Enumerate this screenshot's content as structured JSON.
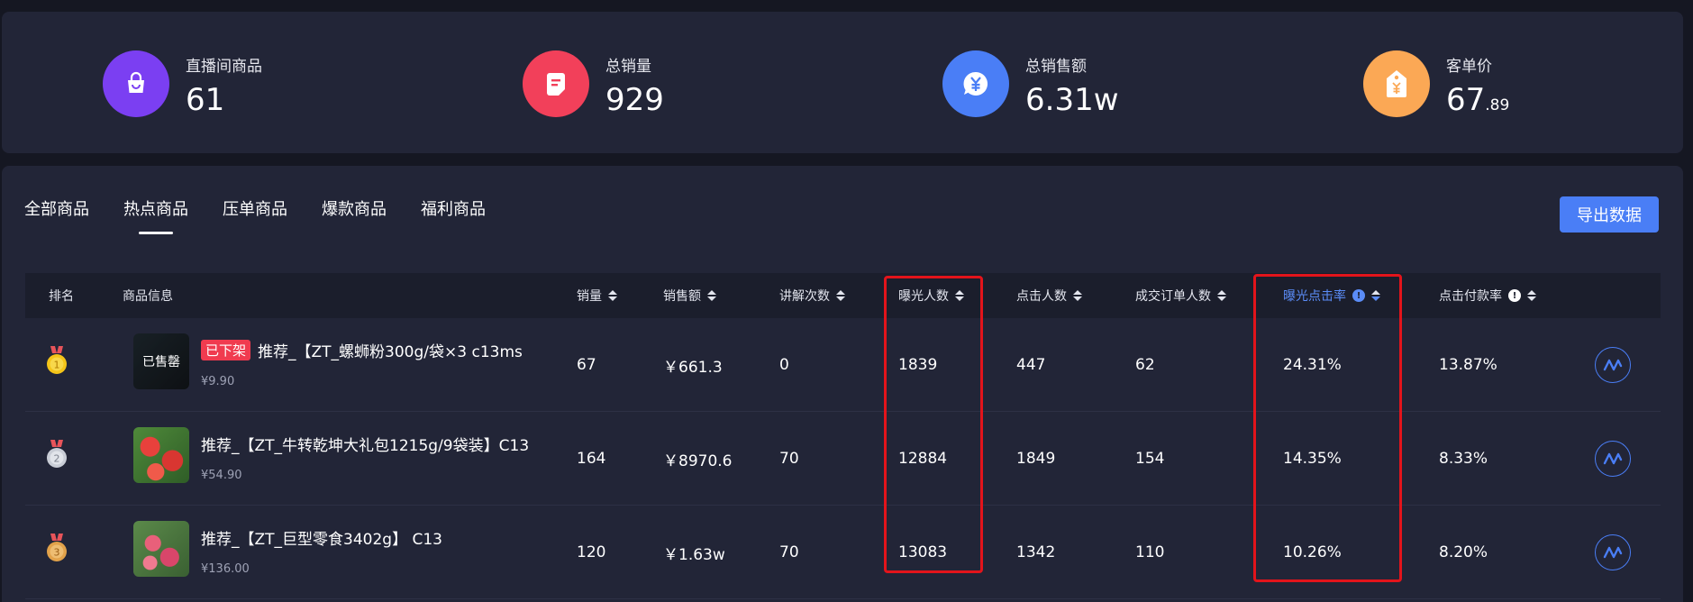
{
  "stats": [
    {
      "label": "直播间商品",
      "value": "61",
      "decimal": "",
      "icon": "shopping-bag-icon",
      "color": "#7b3ff2"
    },
    {
      "label": "总销量",
      "value": "929",
      "decimal": "",
      "icon": "document-icon",
      "color": "#f2405a"
    },
    {
      "label": "总销售额",
      "value": "6.31w",
      "decimal": "",
      "icon": "yuan-bubble-icon",
      "color": "#4a7ef6"
    },
    {
      "label": "客单价",
      "value": "67",
      "decimal": ".89",
      "icon": "price-tag-icon",
      "color": "#fba855"
    }
  ],
  "tabs": [
    {
      "label": "全部商品",
      "active": false
    },
    {
      "label": "热点商品",
      "active": true
    },
    {
      "label": "压单商品",
      "active": false
    },
    {
      "label": "爆款商品",
      "active": false
    },
    {
      "label": "福利商品",
      "active": false
    }
  ],
  "export_label": "导出数据",
  "columns": [
    {
      "label": "排名",
      "sortable": false
    },
    {
      "label": "商品信息",
      "sortable": false
    },
    {
      "label": "销量",
      "sortable": true
    },
    {
      "label": "销售额",
      "sortable": true
    },
    {
      "label": "讲解次数",
      "sortable": true
    },
    {
      "label": "曝光人数",
      "sortable": true
    },
    {
      "label": "点击人数",
      "sortable": true
    },
    {
      "label": "成交订单人数",
      "sortable": true
    },
    {
      "label": "曝光点击率",
      "sortable": true,
      "info": true,
      "active": true
    },
    {
      "label": "点击付款率",
      "sortable": true,
      "info": true
    }
  ],
  "rows": [
    {
      "rank": "1",
      "medal_color": "#f5c518",
      "badge": "已下架",
      "thumb_overlay": "已售罄",
      "name": "推荐_【ZT_螺蛳粉300g/袋×3 c13ms",
      "price": "¥9.90",
      "sales": "67",
      "revenue": "￥661.3",
      "explain": "0",
      "exposure": "1839",
      "clicks": "447",
      "orders": "62",
      "ctr": "24.31%",
      "pay_rate": "13.87%"
    },
    {
      "rank": "2",
      "medal_color": "#c9cdd6",
      "badge": "",
      "thumb_overlay": "",
      "name": "推荐_【ZT_牛转乾坤大礼包1215g/9袋装】C13",
      "price": "¥54.90",
      "sales": "164",
      "revenue": "￥8970.6",
      "explain": "70",
      "exposure": "12884",
      "clicks": "1849",
      "orders": "154",
      "ctr": "14.35%",
      "pay_rate": "8.33%"
    },
    {
      "rank": "3",
      "medal_color": "#e2a24a",
      "badge": "",
      "thumb_overlay": "",
      "name": "推荐_【ZT_巨型零食3402g】 C13",
      "price": "¥136.00",
      "sales": "120",
      "revenue": "￥1.63w",
      "explain": "70",
      "exposure": "13083",
      "clicks": "1342",
      "orders": "110",
      "ctr": "10.26%",
      "pay_rate": "8.20%"
    }
  ],
  "colors": {
    "highlight": "#e3141b",
    "accent": "#4a7ef6",
    "off_badge": "#f03b4f"
  }
}
